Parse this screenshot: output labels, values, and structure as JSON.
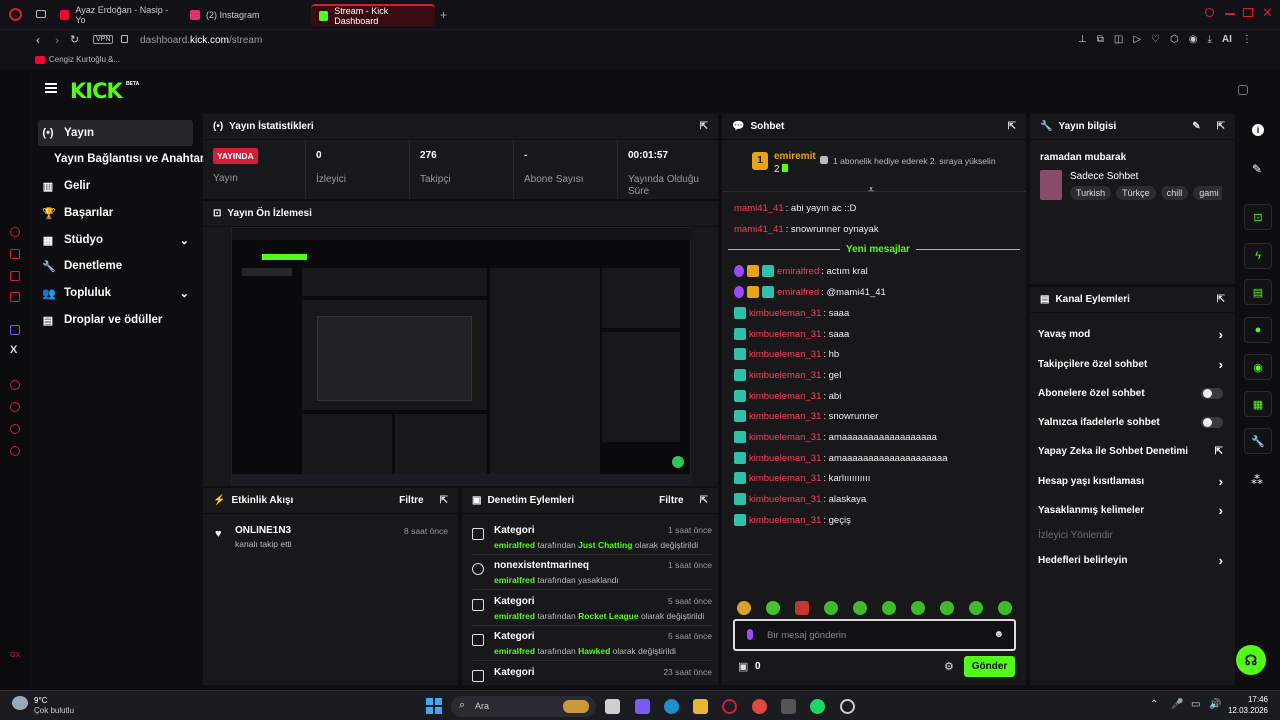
{
  "browser": {
    "tabs": [
      {
        "label": "Ayaz Erdoğan - Nasip - Yo",
        "color": "#ff0033"
      },
      {
        "label": "(2) Instagram",
        "color": "#e1306c"
      },
      {
        "label": "Stream - Kick Dashboard",
        "color": "#53fc18"
      }
    ],
    "vpn": "VPN",
    "url_host": "dashboard.",
    "url_domain": "kick.com",
    "url_path": "/stream",
    "ai_label": "AI",
    "bookmark": "Cengiz Kurtoğlu &..."
  },
  "brand": {
    "logo": "KICK",
    "beta": "BETA",
    "accent": "#53fc18",
    "live_red": "#d21d3b"
  },
  "nav": {
    "items": [
      {
        "label": "Yayın",
        "icon": "(•)"
      },
      {
        "label": "Yayın Bağlantısı ve Anahtarı",
        "icon": ""
      },
      {
        "label": "Gelir",
        "icon": "▥"
      },
      {
        "label": "Başarılar",
        "icon": "🏆"
      },
      {
        "label": "Stüdyo",
        "icon": "▦"
      },
      {
        "label": "Denetleme",
        "icon": "🔧"
      },
      {
        "label": "Topluluk",
        "icon": "👥"
      },
      {
        "label": "Droplar ve ödüller",
        "icon": "▤"
      }
    ]
  },
  "stats": {
    "title": "Yayın İstatistikleri",
    "live_badge": "YAYINDA",
    "live_label": "Yayın",
    "viewers_value": "0",
    "viewers_label": "İzleyici",
    "followers_value": "276",
    "followers_label": "Takipçi",
    "subs_value": "-",
    "subs_label": "Abone Sayısı",
    "uptime_value": "00:01:57",
    "uptime_label": "Yayında Olduğu Süre"
  },
  "preview": {
    "title": "Yayın Ön İzlemesi"
  },
  "activity": {
    "title": "Etkinlik Akışı",
    "filter": "Filtre",
    "items": [
      {
        "user": "ONLINE1N3",
        "text": "kanalı takip etti",
        "time": "8 saat önce"
      }
    ]
  },
  "moderation": {
    "title": "Denetim Eylemleri",
    "filter": "Filtre",
    "rows": [
      {
        "title": "Kategori",
        "time": "1 saat önce",
        "user": "emiralfred",
        "mid": "tarafından",
        "target": "Just Chatting",
        "tail": "olarak değiştirildi"
      },
      {
        "title": "nonexistentmarineq",
        "time": "1 saat önce",
        "user": "emiralfred",
        "mid": "tarafından yasaklandı",
        "target": "",
        "tail": ""
      },
      {
        "title": "Kategori",
        "time": "5 saat önce",
        "user": "emiralfred",
        "mid": "tarafından",
        "target": "Rocket League",
        "tail": "olarak değiştirildi"
      },
      {
        "title": "Kategori",
        "time": "5 saat önce",
        "user": "emiralfred",
        "mid": "tarafından",
        "target": "Hawked",
        "tail": "olarak değiştirildi"
      },
      {
        "title": "Kategori",
        "time": "23 saat önce",
        "user": "",
        "mid": "",
        "target": "",
        "tail": ""
      }
    ]
  },
  "chat": {
    "title": "Sohbet",
    "pinned": {
      "rank": "1",
      "user": "emiremit",
      "count": "2",
      "text": "1 abonelik hediye ederek 2. sıraya yükselin"
    },
    "new_messages": "Yeni mesajlar",
    "messages": [
      {
        "user": "mami41_41",
        "text": ": abi yayın ac ::D",
        "badges": ""
      },
      {
        "user": "mami41_41",
        "text": ": snowrunner oynayak",
        "badges": ""
      },
      {
        "user": "emiralfred",
        "text": ": actım kral",
        "badges": "mod"
      },
      {
        "user": "emiralfred",
        "text": ": @mami41_41",
        "badges": "mod"
      },
      {
        "user": "kimbueleman_31",
        "text": ": saaa",
        "badges": "sub"
      },
      {
        "user": "kimbueleman_31",
        "text": ": saaa",
        "badges": "sub"
      },
      {
        "user": "kimbueleman_31",
        "text": ": hb",
        "badges": "sub"
      },
      {
        "user": "kimbueleman_31",
        "text": ": gel",
        "badges": "sub"
      },
      {
        "user": "kimbueleman_31",
        "text": ": abi",
        "badges": "sub"
      },
      {
        "user": "kimbueleman_31",
        "text": ": snowrunner",
        "badges": "sub"
      },
      {
        "user": "kimbueleman_31",
        "text": ": amaaaaaaaaaaaaaaaaaa",
        "badges": "sub"
      },
      {
        "user": "kimbueleman_31",
        "text": ": amaaaaaaaaaaaaaaaaaaaa",
        "badges": "sub"
      },
      {
        "user": "kimbueleman_31",
        "text": ": karlıııııııııı",
        "badges": "sub"
      },
      {
        "user": "kimbueleman_31",
        "text": ": alaskaya",
        "badges": "sub"
      },
      {
        "user": "kimbueleman_31",
        "text": ": geçiş",
        "badges": "sub"
      }
    ],
    "input_placeholder": "Bir mesaj gönderin",
    "points": "0",
    "send": "Gönder"
  },
  "stream_info": {
    "title": "Yayın bilgisi",
    "stream_title": "ramadan mubarak",
    "category": "Sadece Sohbet",
    "tags": [
      "Turkish",
      "Türkçe",
      "chill",
      "gami"
    ]
  },
  "channel_actions": {
    "title": "Kanal Eylemleri",
    "items": [
      {
        "label": "Yavaş mod",
        "control": "arrow"
      },
      {
        "label": "Takipçilere özel sohbet",
        "control": "arrow"
      },
      {
        "label": "Abonelere özel sohbet",
        "control": "toggle"
      },
      {
        "label": "Yalnızca ifadelerle sohbet",
        "control": "toggle"
      },
      {
        "label": "Yapay Zeka ile Sohbet Denetimi",
        "control": "external"
      },
      {
        "label": "Hesap yaşı kısıtlaması",
        "control": "arrow"
      },
      {
        "label": "Yasaklanmış kelimeler",
        "control": "arrow"
      },
      {
        "label": "İzleyici Yönlendir",
        "control": "none"
      },
      {
        "label": "Hedefleri belirleyin",
        "control": "arrow"
      }
    ]
  },
  "taskbar": {
    "weather_temp": "9°C",
    "weather_desc": "Çok bulutlu",
    "search": "Ara",
    "time": "17:46",
    "date": "12.03.2026"
  }
}
